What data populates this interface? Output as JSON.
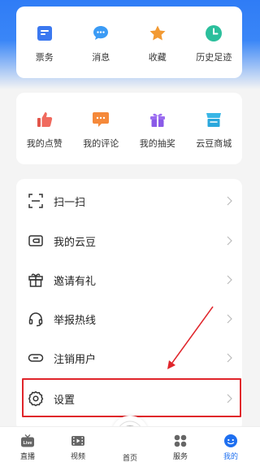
{
  "quick_actions": [
    {
      "label": "票务",
      "icon": "ticket-icon"
    },
    {
      "label": "消息",
      "icon": "message-icon"
    },
    {
      "label": "收藏",
      "icon": "star-icon"
    },
    {
      "label": "历史足迹",
      "icon": "history-clock-icon"
    }
  ],
  "activity_actions": [
    {
      "label": "我的点赞",
      "icon": "thumbs-up-icon"
    },
    {
      "label": "我的评论",
      "icon": "comment-icon"
    },
    {
      "label": "我的抽奖",
      "icon": "gift-icon"
    },
    {
      "label": "云豆商城",
      "icon": "shop-icon"
    }
  ],
  "menu": [
    {
      "label": "扫一扫",
      "icon": "scan-icon"
    },
    {
      "label": "我的云豆",
      "icon": "wallet-icon"
    },
    {
      "label": "邀请有礼",
      "icon": "gift-outline-icon"
    },
    {
      "label": "举报热线",
      "icon": "headset-icon"
    },
    {
      "label": "注销用户",
      "icon": "link-icon"
    },
    {
      "label": "设置",
      "icon": "gear-icon"
    }
  ],
  "tabs": [
    {
      "label": "直播",
      "icon": "live-tv-icon"
    },
    {
      "label": "视频",
      "icon": "film-icon"
    },
    {
      "label": "首页",
      "icon": "eye-logo-icon"
    },
    {
      "label": "服务",
      "icon": "grid-icon"
    },
    {
      "label": "我的",
      "icon": "profile-face-icon"
    }
  ],
  "live_badge": "Live",
  "colors": {
    "accent": "#1e6ff0",
    "highlight": "#e0252b",
    "header_blue": "#2f7cf6"
  }
}
